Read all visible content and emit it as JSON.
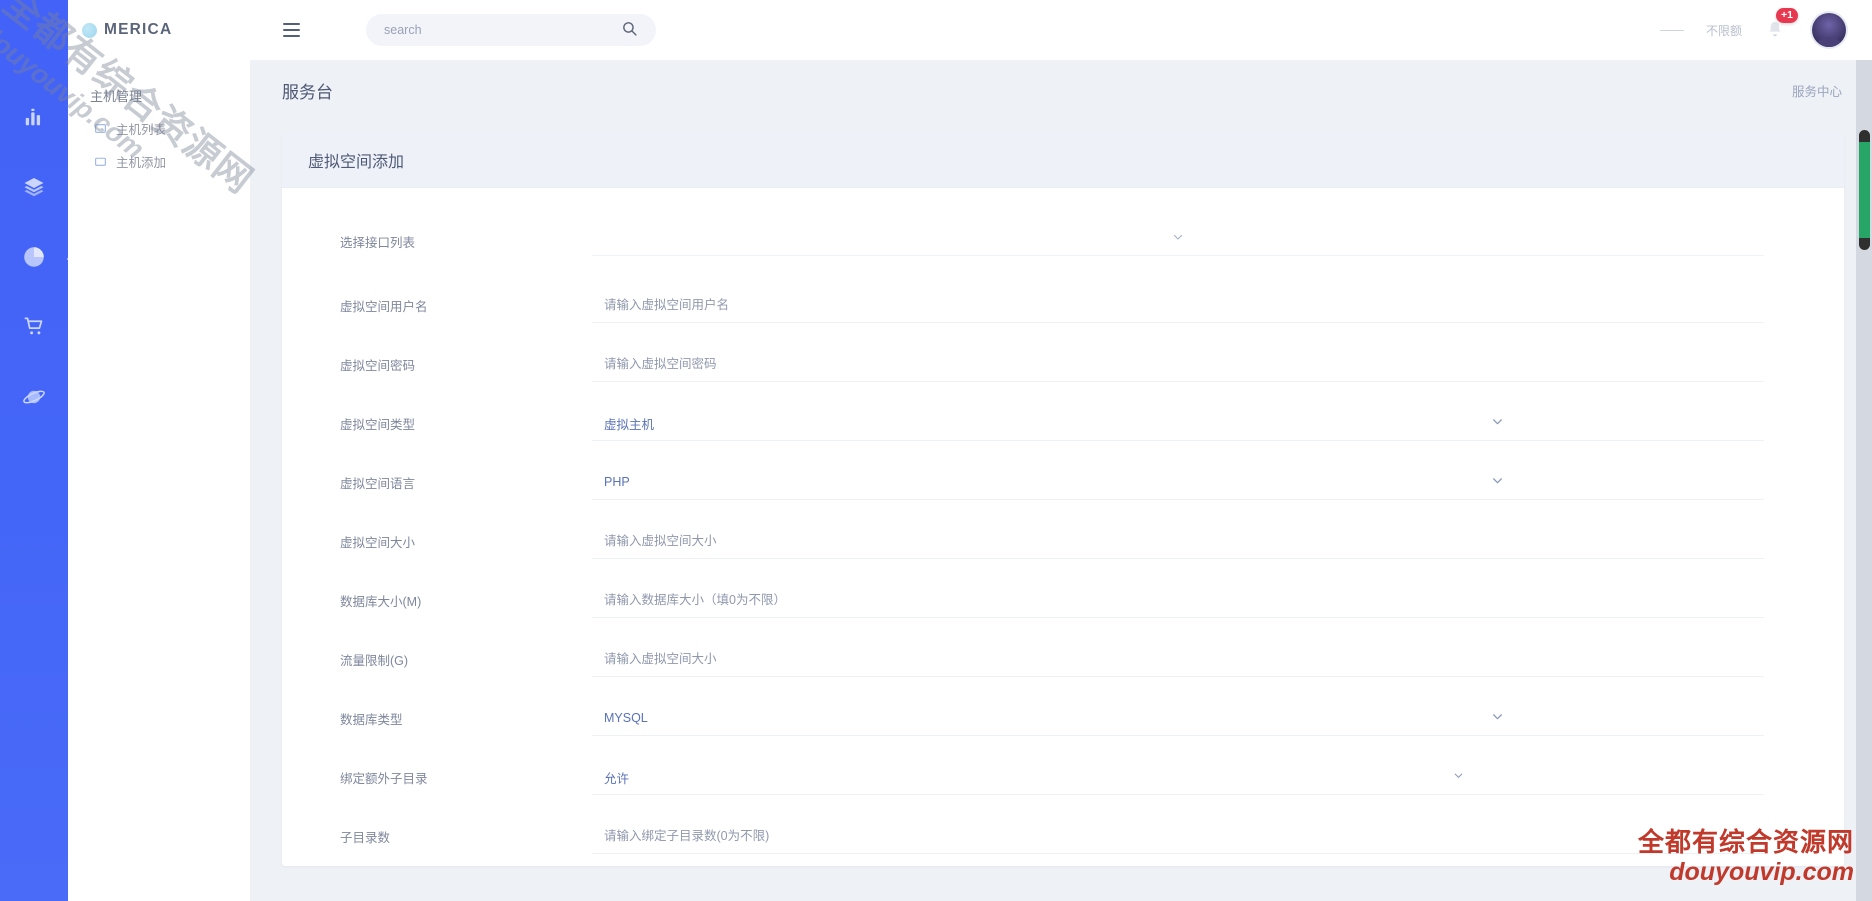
{
  "brand": {
    "name": "MERICA",
    "mark_icon": "brand-dot-icon"
  },
  "rail": {
    "items": [
      {
        "icon": "bar-chart-icon",
        "name": "statistics",
        "active": false
      },
      {
        "icon": "layers-icon",
        "name": "layers",
        "active": false
      },
      {
        "icon": "pie-chart-icon",
        "name": "hosting",
        "active": true
      },
      {
        "icon": "shopping-cart-icon",
        "name": "orders",
        "active": false
      },
      {
        "icon": "planet-icon",
        "name": "network",
        "active": false
      }
    ]
  },
  "sidebar": {
    "group_title": "主机管理",
    "items": [
      {
        "label": "主机列表",
        "icon": "list-icon"
      },
      {
        "label": "主机添加",
        "icon": "folder-plus-icon"
      }
    ]
  },
  "topbar": {
    "menu_icon": "hamburger-icon",
    "search": {
      "placeholder": "search",
      "value": "",
      "icon": "search-icon"
    },
    "divider": "—",
    "balance_label": "不限额",
    "bell_icon": "bell-icon",
    "notification_count": "+1",
    "avatar_name": "user-avatar"
  },
  "page": {
    "title": "服务台",
    "right_link": "服务中心"
  },
  "card": {
    "title": "虚拟空间添加",
    "interface_label": "选择接口列表",
    "interface_value": "",
    "rows": [
      {
        "label": "虚拟空间用户名",
        "type": "input",
        "value": "",
        "placeholder": "请输入虚拟空间用户名"
      },
      {
        "label": "虚拟空间密码",
        "type": "input",
        "value": "",
        "placeholder": "请输入虚拟空间密码"
      },
      {
        "label": "虚拟空间类型",
        "type": "select",
        "value": "虚拟主机"
      },
      {
        "label": "虚拟空间语言",
        "type": "select",
        "value": "PHP"
      },
      {
        "label": "虚拟空间大小",
        "type": "input",
        "value": "",
        "placeholder": "请输入虚拟空间大小"
      },
      {
        "label": "数据库大小(M)",
        "type": "input",
        "value": "",
        "placeholder": "请输入数据库大小（填0为不限）"
      },
      {
        "label": "流量限制(G)",
        "type": "input",
        "value": "",
        "placeholder": "请输入虚拟空间大小"
      },
      {
        "label": "数据库类型",
        "type": "select",
        "value": "MYSQL"
      },
      {
        "label": "绑定额外子目录",
        "type": "select",
        "value": "允许"
      },
      {
        "label": "子目录数",
        "type": "input",
        "value": "",
        "placeholder": "请输入绑定子目录数(0为不限)"
      }
    ]
  },
  "watermark": {
    "diagonal_line1": "全都有综合资源网",
    "diagonal_line2": "douyouvip.com",
    "corner_line1": "全都有综合资源网",
    "corner_line2": "douyouvip.com",
    "corner_color": "#c0392b"
  }
}
